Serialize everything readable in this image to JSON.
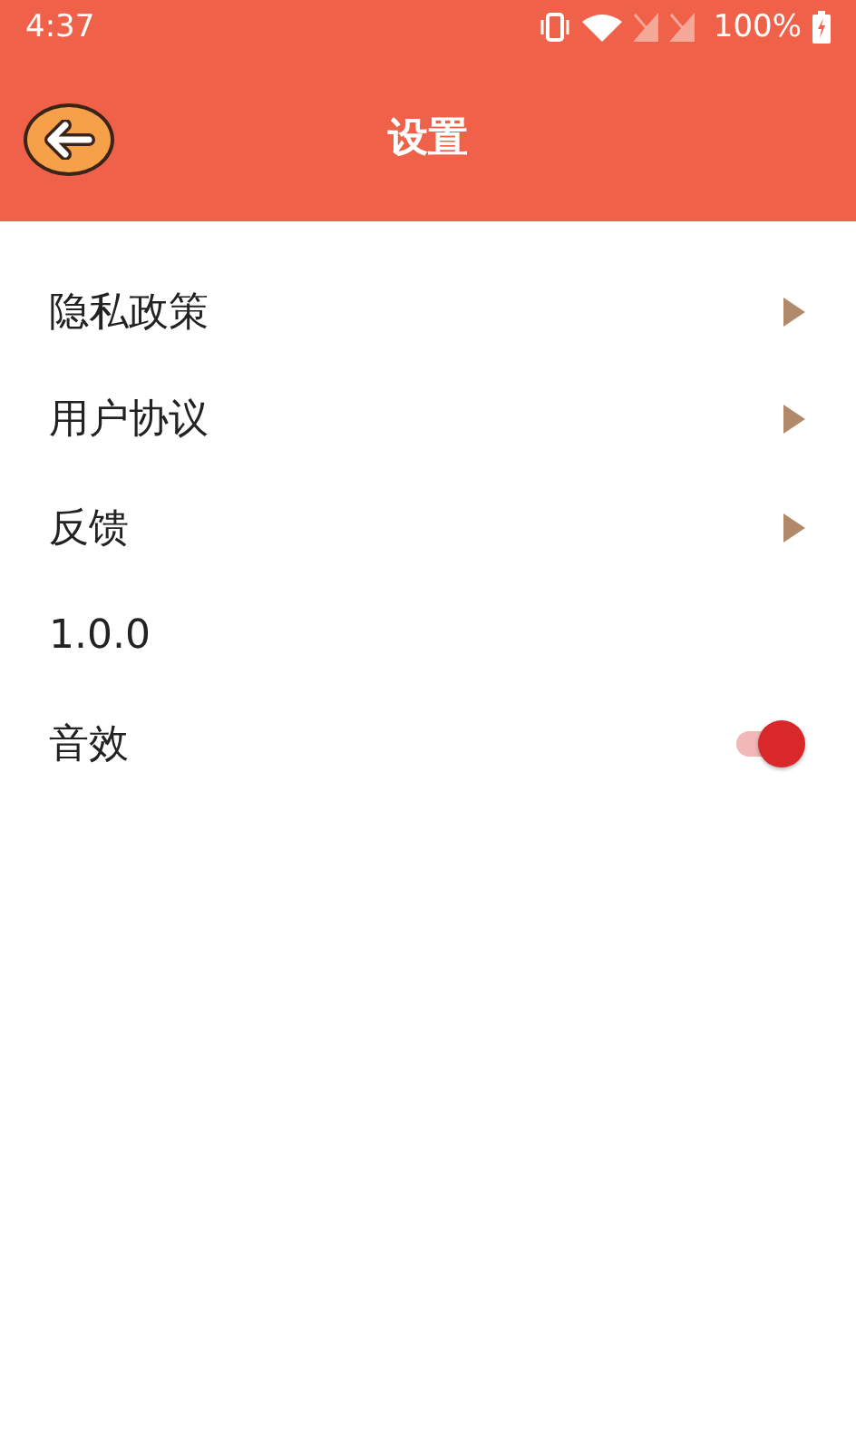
{
  "status_bar": {
    "time": "4:37",
    "battery": "100%"
  },
  "header": {
    "title": "设置"
  },
  "items": [
    {
      "kind": "link",
      "label": "隐私政策"
    },
    {
      "kind": "link",
      "label": "用户协议"
    },
    {
      "kind": "link",
      "label": "反馈"
    },
    {
      "kind": "text",
      "label": "1.0.0"
    },
    {
      "kind": "toggle",
      "label": "音效",
      "on": true
    }
  ]
}
